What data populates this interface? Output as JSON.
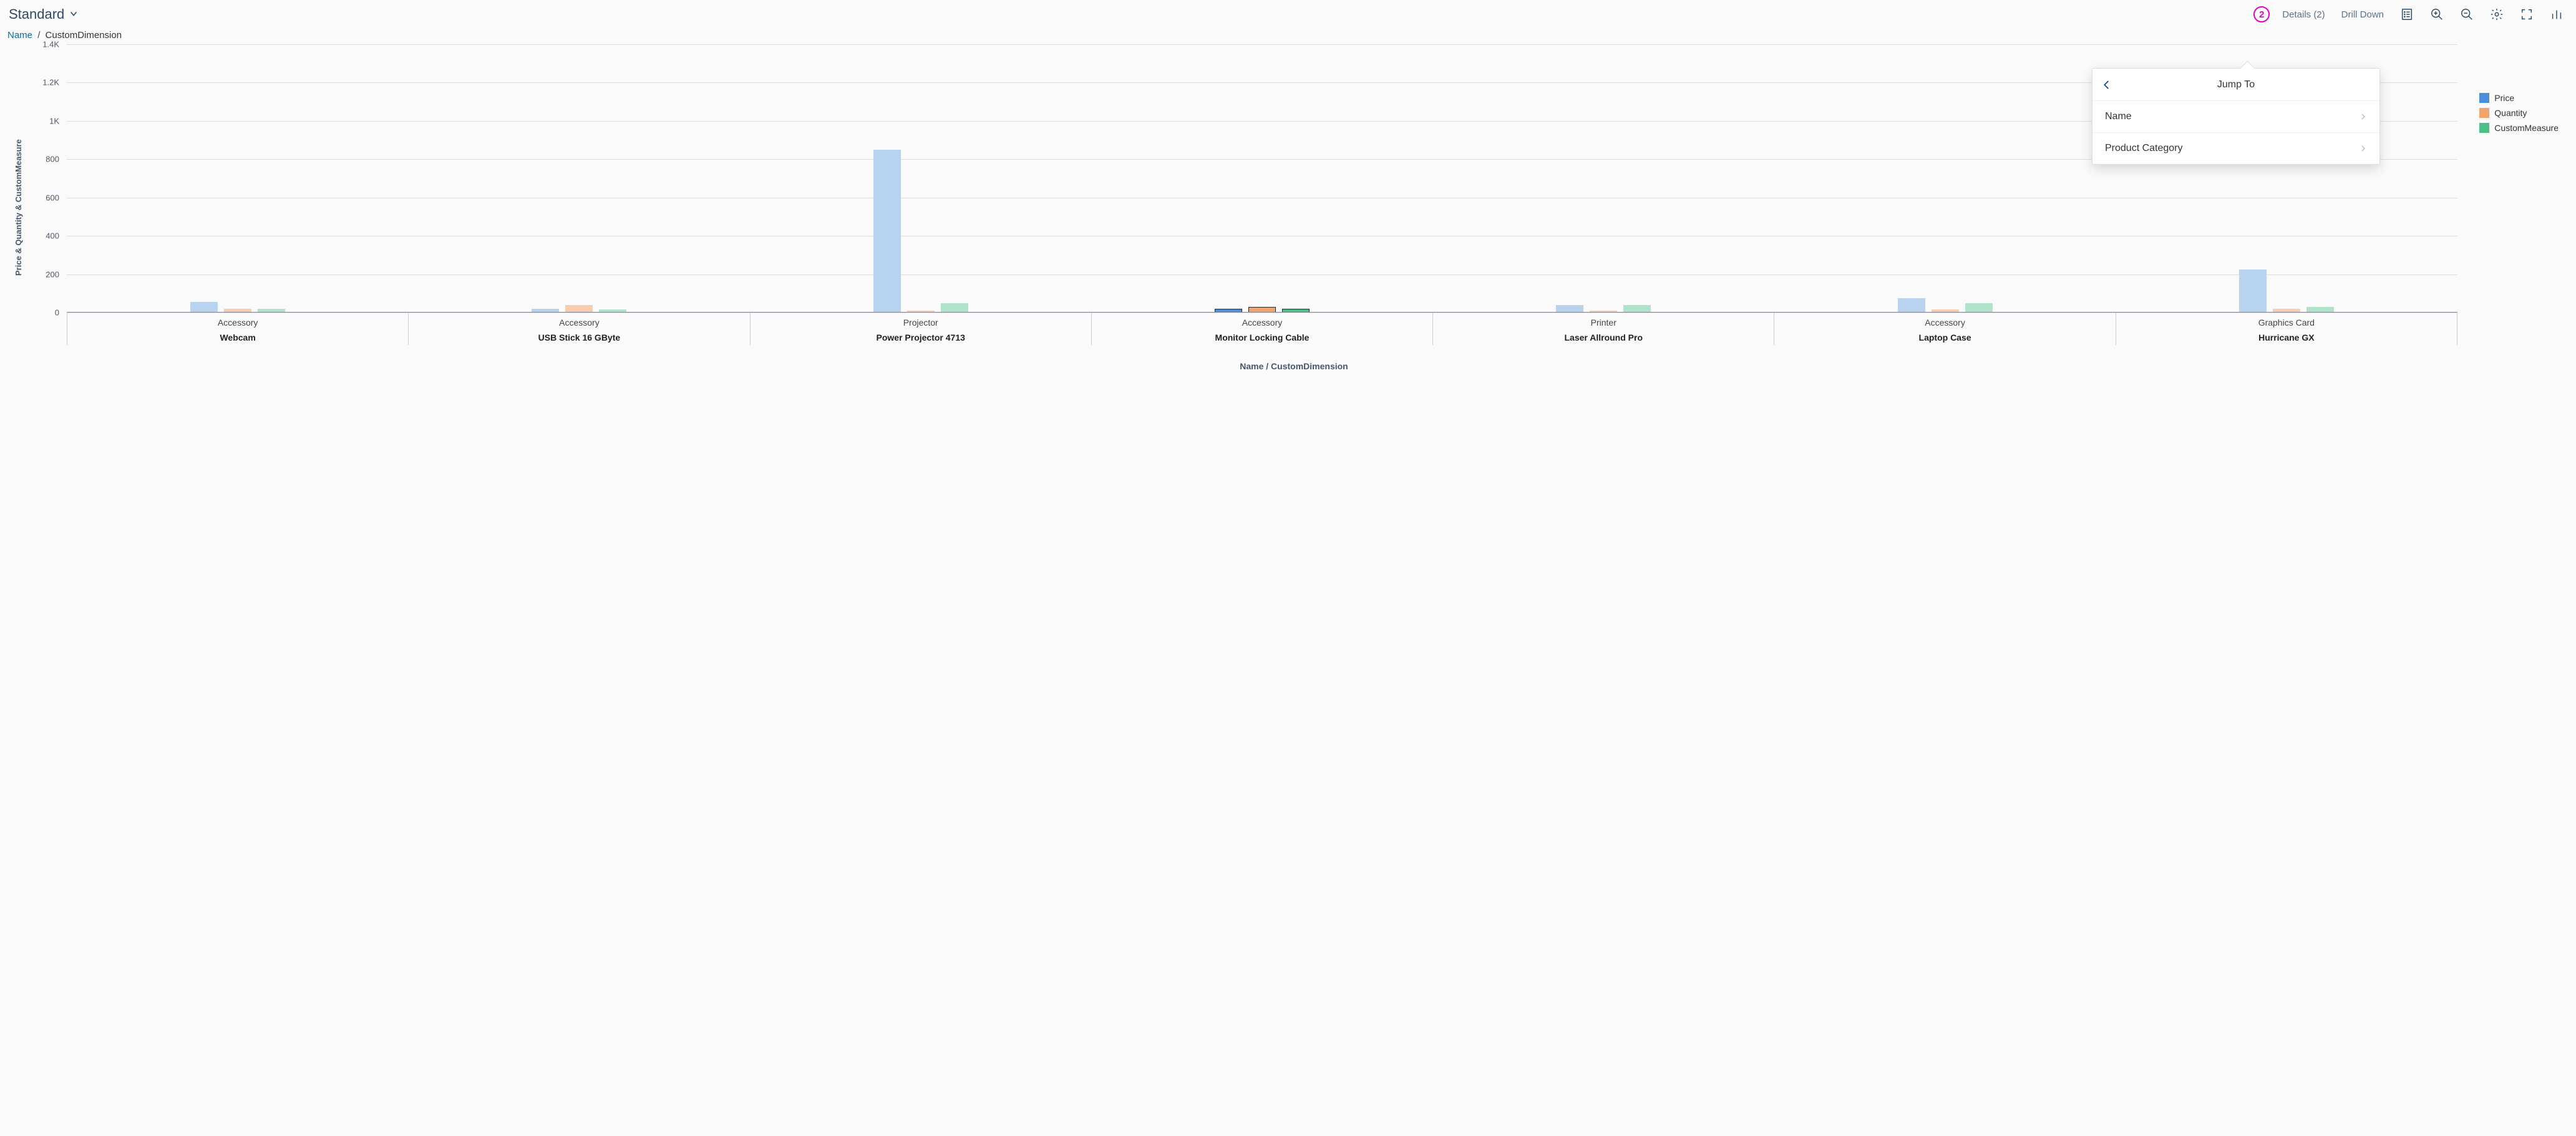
{
  "toolbar": {
    "view_mode": "Standard",
    "badge_number": "2",
    "details_label": "Details (2)",
    "drilldown_label": "Drill Down"
  },
  "breadcrumb": {
    "link": "Name",
    "current": "CustomDimension"
  },
  "popover": {
    "title": "Jump To",
    "items": [
      "Name",
      "Product Category"
    ]
  },
  "legend": {
    "series": [
      {
        "label": "Price",
        "color": "#4b8edc"
      },
      {
        "label": "Quantity",
        "color": "#f2a36a"
      },
      {
        "label": "CustomMeasure",
        "color": "#4dc088"
      }
    ]
  },
  "axes": {
    "y_title": "Price & Quantity & CustomMeasure",
    "x_title": "Name / CustomDimension",
    "y_ticks": [
      "0",
      "200",
      "400",
      "600",
      "800",
      "1K",
      "1.2K",
      "1.4K"
    ]
  },
  "chart_data": {
    "type": "bar",
    "ylabel": "Price & Quantity & CustomMeasure",
    "xlabel": "Name / CustomDimension",
    "ylim": [
      0,
      1400
    ],
    "categories_primary": [
      "Webcam",
      "USB Stick 16 GByte",
      "Power Projector 4713",
      "Monitor Locking Cable",
      "Laser Allround Pro",
      "Laptop Case",
      "Hurricane GX"
    ],
    "categories_secondary": [
      "Accessory",
      "Accessory",
      "Projector",
      "Accessory",
      "Printer",
      "Accessory",
      "Graphics Card"
    ],
    "selected_index": 3,
    "series": [
      {
        "name": "Price",
        "color": "#4b8edc",
        "color_dim": "#b8d3ef",
        "values": [
          55,
          20,
          850,
          20,
          40,
          75,
          225
        ]
      },
      {
        "name": "Quantity",
        "color": "#f2a36a",
        "color_dim": "#f7cdaf",
        "values": [
          20,
          40,
          10,
          30,
          10,
          15,
          20
        ]
      },
      {
        "name": "CustomMeasure",
        "color": "#4dc088",
        "color_dim": "#b1e2ca",
        "values": [
          20,
          15,
          50,
          20,
          40,
          50,
          30
        ]
      }
    ]
  }
}
